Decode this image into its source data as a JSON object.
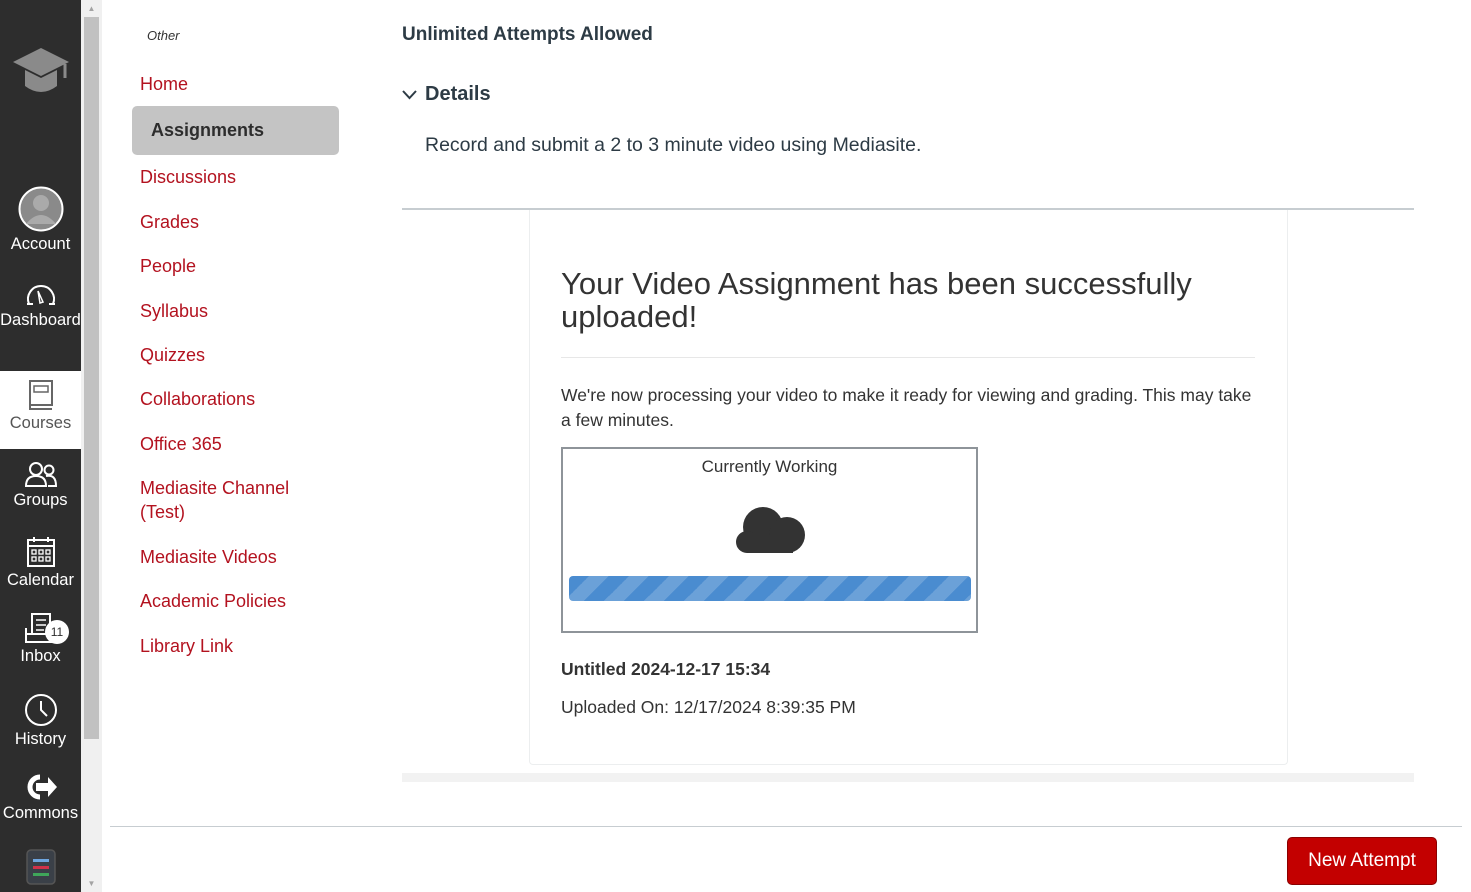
{
  "global_nav": {
    "logo_icon": "graduation-cap-icon",
    "items": [
      {
        "label": "Account",
        "icon": "user-avatar-icon"
      },
      {
        "label": "Dashboard",
        "icon": "speedometer-icon"
      },
      {
        "label": "Courses",
        "icon": "book-icon",
        "active": true
      },
      {
        "label": "Groups",
        "icon": "users-icon"
      },
      {
        "label": "Calendar",
        "icon": "calendar-icon"
      },
      {
        "label": "Inbox",
        "icon": "inbox-icon",
        "badge": "11"
      },
      {
        "label": "History",
        "icon": "clock-icon"
      },
      {
        "label": "Commons",
        "icon": "commons-icon"
      },
      {
        "label": "",
        "icon": "app-menu-icon"
      }
    ]
  },
  "course_nav": {
    "section_label": "Other",
    "items": [
      {
        "label": "Home"
      },
      {
        "label": "Assignments",
        "active": true
      },
      {
        "label": "Discussions"
      },
      {
        "label": "Grades"
      },
      {
        "label": "People"
      },
      {
        "label": "Syllabus"
      },
      {
        "label": "Quizzes"
      },
      {
        "label": "Collaborations"
      },
      {
        "label": "Office 365"
      },
      {
        "label": "Mediasite Channel (Test)"
      },
      {
        "label": "Mediasite Videos"
      },
      {
        "label": "Academic Policies"
      },
      {
        "label": "Library Link"
      }
    ]
  },
  "assignment": {
    "attempts_label": "Unlimited Attempts Allowed",
    "details_label": "Details",
    "details_text": "Record and submit a 2 to 3 minute video using Mediasite."
  },
  "upload_card": {
    "title": "Your Video Assignment has been successfully uploaded!",
    "description": "We're now processing your video to make it ready for viewing and grading. This may take a few minutes.",
    "status_label": "Currently Working",
    "status_icon": "cloud-icon",
    "progress_percent": 100,
    "video_title": "Untitled 2024-12-17 15:34",
    "uploaded_on": "Uploaded On: 12/17/2024 8:39:35 PM"
  },
  "footer": {
    "new_attempt_label": "New Attempt"
  },
  "colors": {
    "nav_bg": "#2d2d2d",
    "link_red": "#b3121f",
    "button_red": "#c30000",
    "progress_blue": "#4a8cd0"
  }
}
